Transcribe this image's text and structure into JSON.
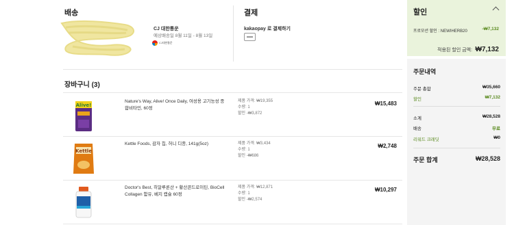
{
  "shipping": {
    "title": "배송",
    "carrier_name": "CJ 대한통운",
    "eta": "예상배송일 8월 11일 - 8월 13일",
    "carrier_logo_text": "CJ대한통운"
  },
  "payment": {
    "title": "결제",
    "method_label": "kakaopay 로 결제하기"
  },
  "cart": {
    "title": "장바구니 (3)",
    "items": [
      {
        "name": "Nature's Way, Alive! Once Daily, 여성용 고기능성 종합비타민, 60정",
        "list_price": "제품 가격: ₩19,355",
        "qty": "수량: 1",
        "discount": "할인 -₩3,872",
        "price": "₩15,483"
      },
      {
        "name": "Kettle Foods, 감자 칩, 허니 디종, 141g(5oz)",
        "list_price": "제품 가격: ₩3,434",
        "qty": "수량: 1",
        "discount": "할인 -₩686",
        "price": "₩2,748"
      },
      {
        "name": "Doctor's Best, 히알루론산 + 황산콘드로이틴, BioCell Collagen 함유, 베지 캡슐 60정",
        "list_price": "제품 가격: ₩12,871",
        "qty": "수량: 1",
        "discount": "할인 -₩2,574",
        "price": "₩10,297"
      }
    ]
  },
  "discount_panel": {
    "title": "할인",
    "promo_label": "프로모션 할인 : NEWIHERB20",
    "promo_value": "-₩7,132",
    "applied_label": "적용된 할인 금액:",
    "applied_value": "₩7,132"
  },
  "order_summary": {
    "title": "주문내역",
    "order_total_label": "주문 총합",
    "order_total_value": "₩35,660",
    "discount_label": "할인",
    "discount_value": "₩7,132",
    "subtotal_label": "소계",
    "subtotal_value": "₩28,528",
    "shipping_label": "배송",
    "shipping_value": "무료",
    "credit_label": "리워드 크레딧",
    "credit_value": "₩0",
    "grand_total_label": "주문 합계",
    "grand_total_value": "₩28,528"
  },
  "colors": {
    "discount_bg": "#eaf3dc",
    "summary_bg": "#f4f4f4",
    "accent_green": "#5a8a1f"
  }
}
